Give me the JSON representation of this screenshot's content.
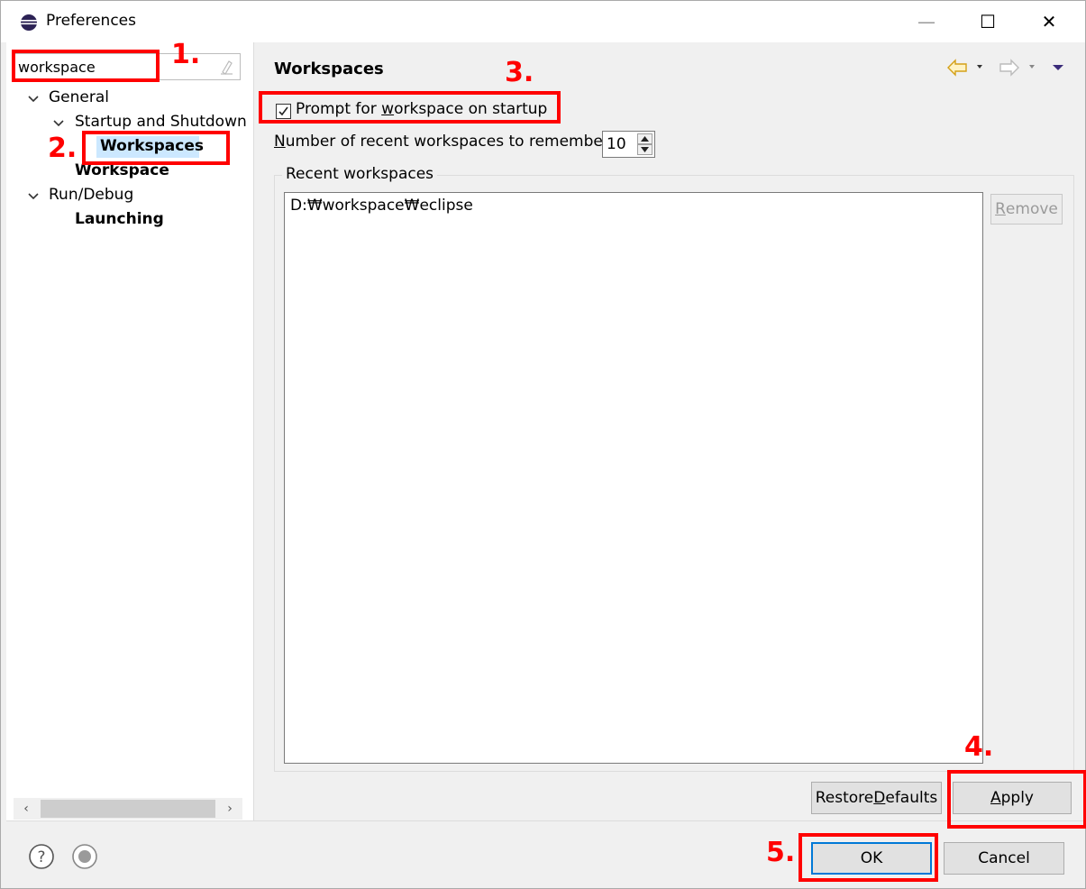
{
  "window": {
    "title": "Preferences",
    "minimize": "—",
    "maximize": "☐",
    "close": "✕"
  },
  "filter": {
    "value": "workspace"
  },
  "tree": {
    "general": "General",
    "startup_shutdown": "Startup and Shutdown",
    "workspaces": "Workspaces",
    "workspace": "Workspace",
    "run_debug": "Run/Debug",
    "launching": "Launching"
  },
  "page": {
    "title": "Workspaces",
    "prompt_checkbox": {
      "pre": "Prompt for ",
      "mnemonic": "w",
      "post": "orkspace on startup",
      "checked": true
    },
    "recent_count_label": {
      "mnemonic": "N",
      "post": "umber of recent workspaces to remember:"
    },
    "recent_count_value": "10",
    "recent_group_label": "Recent workspaces",
    "recent_items": [
      "D:₩workspace₩eclipse"
    ],
    "remove_button": {
      "mnemonic": "R",
      "post": "emove"
    }
  },
  "buttons": {
    "restore_defaults": {
      "pre": "Restore ",
      "mnemonic": "D",
      "post": "efaults"
    },
    "apply": {
      "mnemonic": "A",
      "post": "pply"
    },
    "ok": "OK",
    "cancel": "Cancel"
  },
  "annotations": {
    "step1": "1.",
    "step2": "2.",
    "step3": "3.",
    "step4": "4.",
    "step5": "5."
  },
  "colors": {
    "annotation": "#ff0000",
    "selection": "#cce8ff",
    "default_button_border": "#0078d7"
  }
}
